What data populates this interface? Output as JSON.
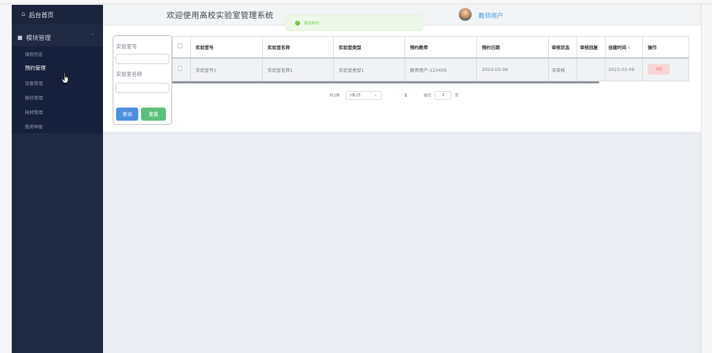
{
  "sidebar": {
    "home": "后台首页",
    "group": "模块管理",
    "items": [
      "课程信息",
      "预约管理",
      "设备管理",
      "报修管理",
      "耗材管理",
      "教师申报"
    ]
  },
  "header": {
    "title": "欢迎使用高校实验室管理系统",
    "toast": "提交成功！",
    "user": "教师用户"
  },
  "search": {
    "label1": "实验室号",
    "label2": "实验室名称",
    "query_button": "查询",
    "reset_button": "重置"
  },
  "table": {
    "columns": [
      "实验室号",
      "实验室名称",
      "实验室类型",
      "预约教师",
      "预约日期",
      "审核状态",
      "审核回复",
      "创建时间",
      "操作"
    ],
    "rows": [
      {
        "lab_no": "实验室号1",
        "lab_name": "实验室名称1",
        "lab_type": "实验室类型1",
        "teacher": "教师用户-123456",
        "date": "2023-03-09",
        "status": "未审核",
        "reply": "",
        "created": "2023-03-09",
        "action": "详情"
      }
    ]
  },
  "pagination": {
    "total": "共1条",
    "page_size": "7条/页",
    "current_page": "1",
    "goto_label": "前往",
    "goto_value": "1",
    "page_suffix": "页"
  },
  "colors": {
    "sidebar_bg": "#1f2a40",
    "primary": "#4d8fe0",
    "success": "#5cc07c",
    "danger_light": "#f6d6d6"
  }
}
